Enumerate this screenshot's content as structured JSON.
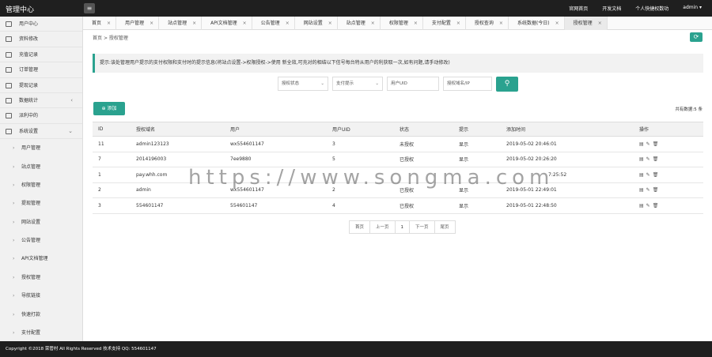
{
  "app": {
    "title": "管理中心"
  },
  "topnav": {
    "items": [
      "官网首页",
      "开发文档",
      "个人快捷权数功",
      "admin ▾"
    ]
  },
  "sidebar": {
    "items": [
      {
        "label": "用户中心"
      },
      {
        "label": "资料修改"
      },
      {
        "label": "充值记录"
      },
      {
        "label": "订单管理"
      },
      {
        "label": "提现记录"
      },
      {
        "label": "数据统计",
        "arrow": "‹"
      },
      {
        "label": "派利中的"
      },
      {
        "label": "系统设置",
        "arrow": "⌄"
      }
    ],
    "subitems": [
      "用户管理",
      "站点管理",
      "权限管理",
      "提现管理",
      "网站设置",
      "公告管理",
      "API文档管理",
      "授权管理",
      "导航链接",
      "快速打款",
      "支付配置"
    ]
  },
  "tabs": [
    {
      "label": "首页",
      "active": false
    },
    {
      "label": "用户管理",
      "active": false
    },
    {
      "label": "站点管理",
      "active": false
    },
    {
      "label": "API文档管理",
      "active": false
    },
    {
      "label": "公告管理",
      "active": false
    },
    {
      "label": "网站设置",
      "active": false
    },
    {
      "label": "站点管理",
      "active": false
    },
    {
      "label": "权限管理",
      "active": false
    },
    {
      "label": "支付配置",
      "active": false
    },
    {
      "label": "授权查询",
      "active": false
    },
    {
      "label": "系统数据(今日)",
      "active": false
    },
    {
      "label": "授权管理",
      "active": true
    }
  ],
  "breadcrumb": {
    "home": "首页",
    "sep": ">",
    "current": "授权管理"
  },
  "notice": "提示:该处管理用户提示的支付权限和支付时的提示信息(将站点设置->权限授权->使用 新全效,可充对的相结以下信号每台特从用户的利获取一次,如有问题,请手动修改)",
  "filters": {
    "status": "授权状态",
    "display": "支付提示",
    "user_id_placeholder": "用户UID",
    "domain_placeholder": "授权域名/IP"
  },
  "toolbar": {
    "add_label": "添加",
    "total_label": "共有数据:5 条"
  },
  "table": {
    "headers": [
      "ID",
      "授权域名",
      "用户",
      "用户UID",
      "状态",
      "提示",
      "添加时间",
      "操作"
    ],
    "rows": [
      [
        "11",
        "admin123123",
        "wx554601147",
        "3",
        "未授权",
        "显示",
        "2019-05-02 20:46:01"
      ],
      [
        "7",
        "2014196003",
        "7ee9880",
        "5",
        "已授权",
        "显示",
        "2019-05-02 20:26:20"
      ],
      [
        "1",
        "pay.whh.com",
        "",
        "",
        "",
        "",
        "7:25:52"
      ],
      [
        "2",
        "admin",
        "wx554601147",
        "2",
        "已授权",
        "显示",
        "2019-05-01 22:49:01"
      ],
      [
        "3",
        "554601147",
        "554601147",
        "4",
        "已授权",
        "显示",
        "2019-05-01 22:48:50"
      ]
    ]
  },
  "pagination": [
    "首页",
    "上一页",
    "1",
    "下一页",
    "尾页"
  ],
  "footer": "Copyright ©2018 荣管村 All Rights Reserved   技术支持 QQ: 554601147",
  "watermark": "https://www.songma.com",
  "colors": {
    "accent": "#2aa28f",
    "topbar": "#1f1f1f"
  }
}
